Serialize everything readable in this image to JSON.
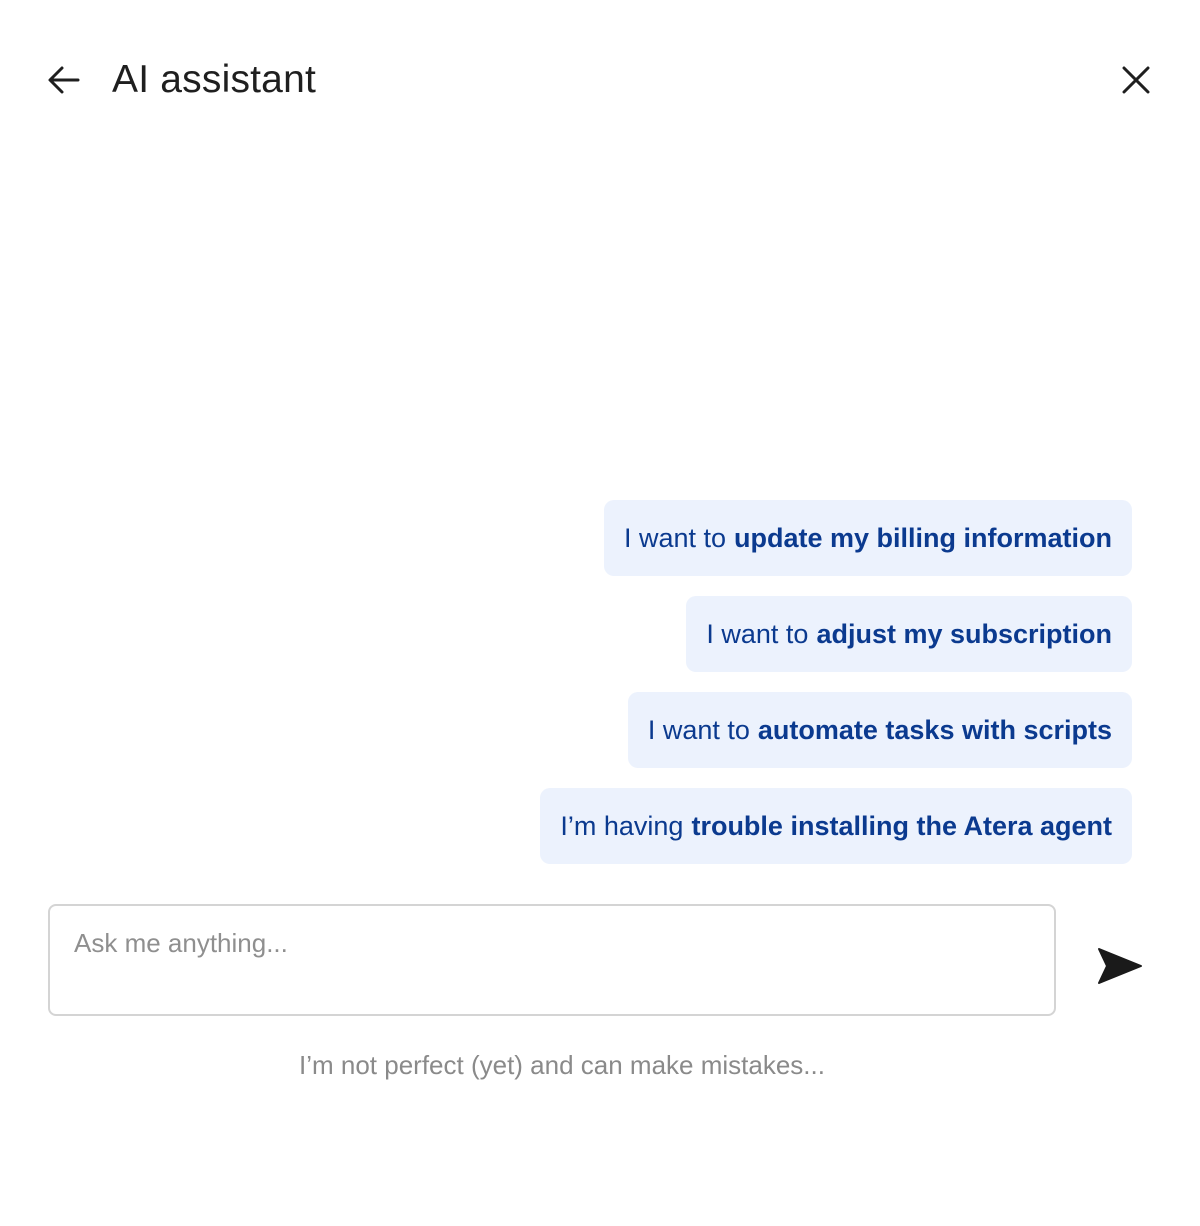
{
  "header": {
    "back_icon": "arrow-left-icon",
    "title": "AI assistant",
    "close_icon": "close-icon"
  },
  "suggestions": [
    {
      "prefix": "I want to",
      "emphasis": "update my billing information"
    },
    {
      "prefix": "I want to",
      "emphasis": "adjust my subscription"
    },
    {
      "prefix": "I want to",
      "emphasis": "automate tasks with scripts"
    },
    {
      "prefix": "I’m having",
      "emphasis": "trouble installing the Atera agent"
    }
  ],
  "input": {
    "value": "",
    "placeholder": "Ask me anything..."
  },
  "send_icon": "send-icon",
  "disclaimer": "I’m not perfect (yet) and can make mistakes...",
  "colors": {
    "chip_background": "#ecf2fd",
    "chip_text": "#0b3a8f",
    "input_border": "#d4d4d4",
    "placeholder": "#8f8f8f",
    "disclaimer": "#8a8a8a"
  }
}
